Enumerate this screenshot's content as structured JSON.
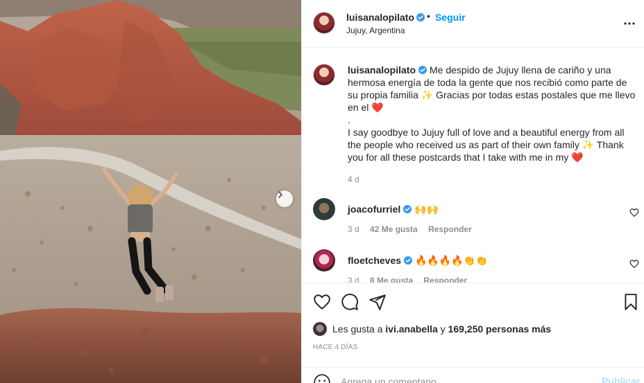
{
  "post": {
    "author": "luisanalopilato",
    "follow_label": "Seguir",
    "separator": "•",
    "location": "Jujuy, Argentina",
    "more_icon": "more-options-icon"
  },
  "caption": {
    "username": "luisanalopilato",
    "text_es": "Me despido de Jujuy llena de cariño y una hermosa energía de toda la gente que nos recibió como parte de su propia familia ✨ Gracias por todas estas postales que me llevo en el ❤️",
    "dot": ".",
    "text_en": "I say goodbye to Jujuy full of love and a beautiful energy from all the people who received us as part of their own family ✨ Thank you for all these postcards that I take with me in my ❤️",
    "time": "4 d"
  },
  "comments": [
    {
      "username": "joacofurriel",
      "text": "🙌🙌",
      "time": "3 d",
      "likes": "42 Me gusta",
      "reply": "Responder"
    },
    {
      "username": "floetcheves",
      "text": "🔥🔥🔥🔥👏👏",
      "time": "3 d",
      "likes": "8 Me gusta",
      "reply": "Responder"
    }
  ],
  "actions": {
    "likes_prefix": "Les gusta a",
    "likes_user": "ivi.anabella",
    "likes_mid": "y",
    "likes_count": "169,250 personas más",
    "time_ago": "HACE 4 DÍAS"
  },
  "composer": {
    "placeholder": "Agrega un comentario...",
    "publish_label": "Publicar"
  },
  "colors": {
    "accent": "#0095f6",
    "publish_disabled": "#b2dffc",
    "verified": "#3897f0",
    "secondary_text": "#8e8e8e"
  }
}
